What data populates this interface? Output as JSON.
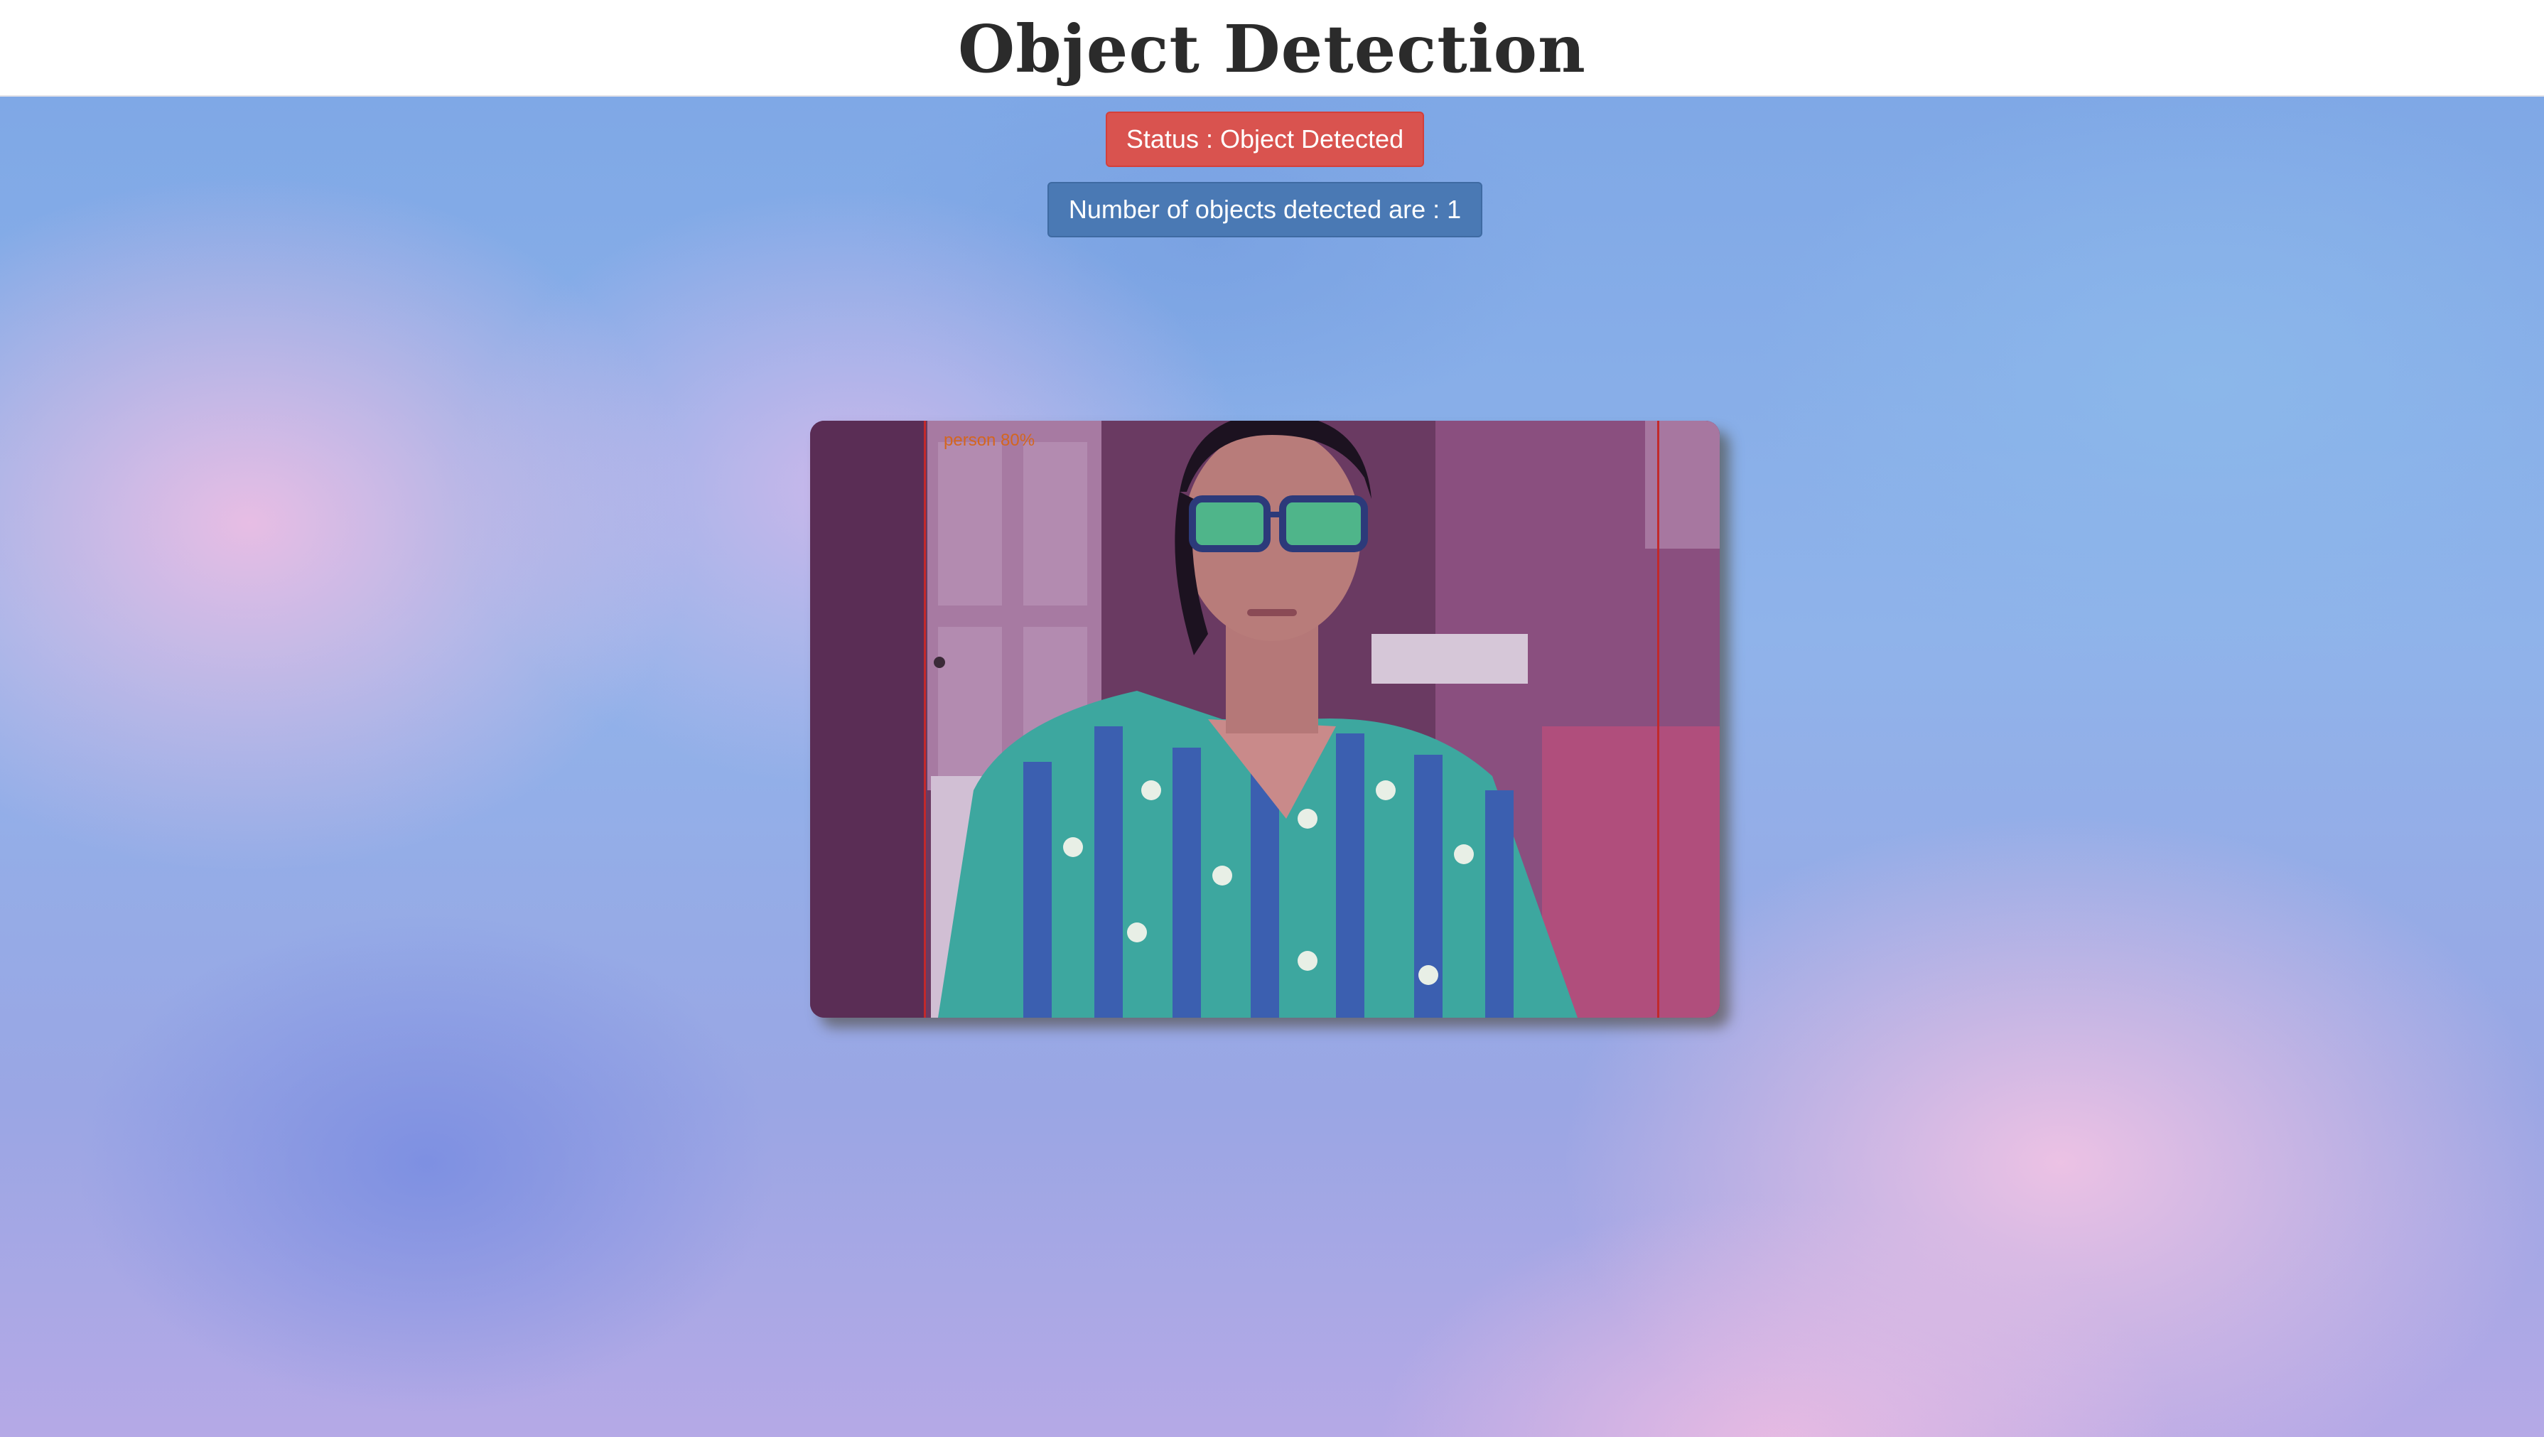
{
  "header": {
    "title": "Object Detection"
  },
  "status": {
    "label": "Status : Object Detected"
  },
  "count": {
    "label": "Number of objects detected are : 1"
  },
  "video": {
    "detection_label": "person 80%",
    "bbox_color": "#c2292b",
    "label_color": "#d4661e"
  },
  "colors": {
    "status_bg": "#d9534f",
    "count_bg": "#4a79b4"
  }
}
